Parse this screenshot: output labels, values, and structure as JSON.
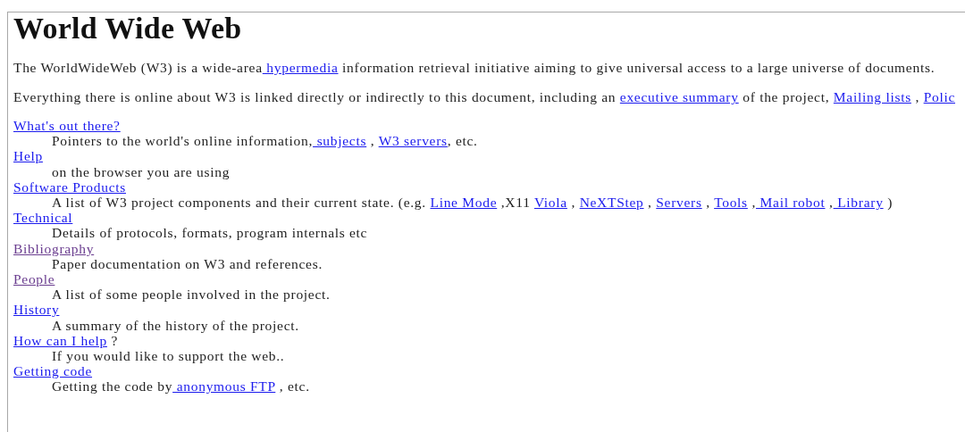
{
  "title": "World Wide Web",
  "paragraphs": [
    [
      {
        "text": "The WorldWideWeb (W3) is a wide-area",
        "link": false
      },
      {
        "text": " hypermedia",
        "link": true,
        "visited": false
      },
      {
        "text": " information retrieval initiative aiming to give universal access to a large universe of documents.",
        "link": false
      }
    ],
    [
      {
        "text": "Everything there is online about W3 is linked directly or indirectly to this document, including an ",
        "link": false
      },
      {
        "text": "executive summary",
        "link": true,
        "visited": false
      },
      {
        "text": " of the project, ",
        "link": false
      },
      {
        "text": "Mailing lists",
        "link": true,
        "visited": false
      },
      {
        "text": " , ",
        "link": false
      },
      {
        "text": "Polic",
        "link": true,
        "visited": false
      }
    ]
  ],
  "entries": [
    {
      "term": [
        {
          "text": "What's out there?",
          "link": true,
          "visited": false
        }
      ],
      "definition": [
        {
          "text": "Pointers to the world's online information,",
          "link": false
        },
        {
          "text": " subjects",
          "link": true,
          "visited": false
        },
        {
          "text": " , ",
          "link": false
        },
        {
          "text": "W3 servers",
          "link": true,
          "visited": false
        },
        {
          "text": ", etc.",
          "link": false
        }
      ]
    },
    {
      "term": [
        {
          "text": "Help",
          "link": true,
          "visited": false
        }
      ],
      "definition": [
        {
          "text": "on the browser you are using",
          "link": false
        }
      ]
    },
    {
      "term": [
        {
          "text": "Software Products",
          "link": true,
          "visited": false
        }
      ],
      "definition": [
        {
          "text": "A list of W3 project components and their current state. (e.g. ",
          "link": false
        },
        {
          "text": "Line Mode",
          "link": true,
          "visited": false
        },
        {
          "text": " ,X11 ",
          "link": false
        },
        {
          "text": "Viola",
          "link": true,
          "visited": false
        },
        {
          "text": " , ",
          "link": false
        },
        {
          "text": "NeXTStep",
          "link": true,
          "visited": false
        },
        {
          "text": " , ",
          "link": false
        },
        {
          "text": "Servers",
          "link": true,
          "visited": false
        },
        {
          "text": " , ",
          "link": false
        },
        {
          "text": "Tools",
          "link": true,
          "visited": false
        },
        {
          "text": " ,",
          "link": false
        },
        {
          "text": " Mail robot",
          "link": true,
          "visited": false
        },
        {
          "text": " ,",
          "link": false
        },
        {
          "text": " Library",
          "link": true,
          "visited": false
        },
        {
          "text": " )",
          "link": false
        }
      ]
    },
    {
      "term": [
        {
          "text": "Technical",
          "link": true,
          "visited": false
        }
      ],
      "definition": [
        {
          "text": "Details of protocols, formats, program internals etc",
          "link": false
        }
      ]
    },
    {
      "term": [
        {
          "text": "Bibliography",
          "link": true,
          "visited": true
        }
      ],
      "definition": [
        {
          "text": "Paper documentation on W3 and references.",
          "link": false
        }
      ]
    },
    {
      "term": [
        {
          "text": "People",
          "link": true,
          "visited": true
        }
      ],
      "definition": [
        {
          "text": "A list of some people involved in the project.",
          "link": false
        }
      ]
    },
    {
      "term": [
        {
          "text": "History",
          "link": true,
          "visited": false
        }
      ],
      "definition": [
        {
          "text": "A summary of the history of the project.",
          "link": false
        }
      ]
    },
    {
      "term": [
        {
          "text": "How can I help",
          "link": true,
          "visited": false
        },
        {
          "text": " ?",
          "link": false
        }
      ],
      "definition": [
        {
          "text": "If you would like to support the web..",
          "link": false
        }
      ]
    },
    {
      "term": [
        {
          "text": "Getting code",
          "link": true,
          "visited": false
        }
      ],
      "definition": [
        {
          "text": "Getting the code by",
          "link": false
        },
        {
          "text": " anonymous FTP",
          "link": true,
          "visited": false
        },
        {
          "text": " , etc.",
          "link": false
        }
      ]
    }
  ]
}
